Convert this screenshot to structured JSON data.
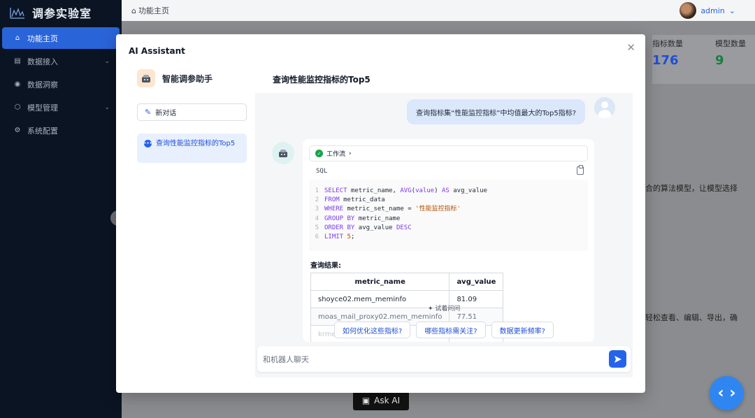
{
  "app": {
    "title": "调参实验室"
  },
  "sidebar": {
    "items": [
      {
        "label": "功能主页",
        "icon": "home-icon"
      },
      {
        "label": "数据接入",
        "icon": "database-icon"
      },
      {
        "label": "数据洞察",
        "icon": "eye-icon"
      },
      {
        "label": "模型管理",
        "icon": "cube-icon"
      },
      {
        "label": "系统配置",
        "icon": "gear-icon"
      }
    ],
    "active_index": 0
  },
  "topbar": {
    "breadcrumb": "功能主页",
    "user": "admin"
  },
  "stats": [
    {
      "label": "指标数量",
      "value": "176",
      "color": "#1d4ed8"
    },
    {
      "label": "模型数量",
      "value": "9",
      "color": "#15803d"
    }
  ],
  "background_text": {
    "line1": "合的算法模型，让模型选择",
    "line2": "轻松查看、编辑、导出，确"
  },
  "ask_ai": {
    "label": "Ask AI"
  },
  "modal": {
    "title": "AI Assistant",
    "assistant_name": "智能调参助手",
    "new_chat_label": "新对话",
    "conversations": [
      {
        "title": "查询性能监控指标的Top5"
      }
    ],
    "chat_title": "查询性能监控指标的Top5"
  },
  "chat": {
    "user_message": "查询指标集“性能监控指标”中均值最大的Top5指标?",
    "workflow_label": "工作流",
    "code_language": "SQL",
    "result_label": "查询结果:",
    "result_table": {
      "columns": [
        "metric_name",
        "avg_value"
      ],
      "rows": [
        [
          "shoyce02.mem_meminfo",
          "81.09"
        ],
        [
          "moas_mail_proxy02.mem_meminfo",
          "77.51"
        ],
        [
          "krme",
          ""
        ]
      ]
    },
    "try_ask_label": "✦ 试着问问",
    "suggestions": [
      "如何优化这些指标?",
      "哪些指标需关注?",
      "数据更新频率?"
    ],
    "input_placeholder": "和机器人聊天"
  },
  "colors": {
    "accent": "#2563eb",
    "sidebar_bg": "#0b1423"
  }
}
